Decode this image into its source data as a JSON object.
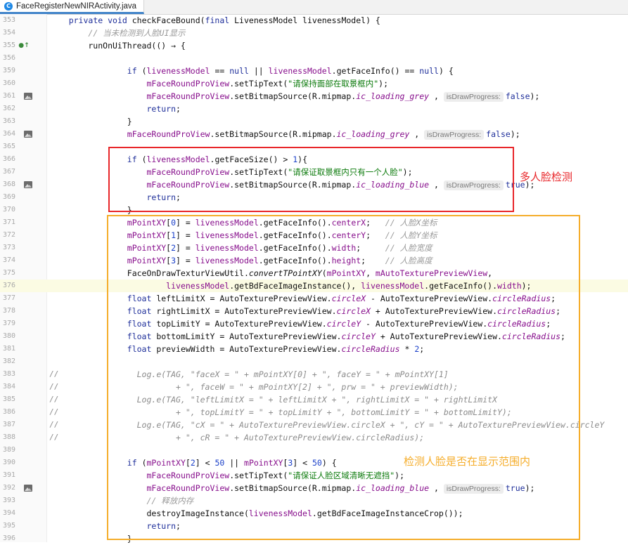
{
  "tab": {
    "icon_letter": "C",
    "label": "FaceRegisterNewNIRActivity.java",
    "accent": "#4083c9"
  },
  "gutter_icons": {
    "override": "override-up-arrow-icon",
    "image": "image-resource-icon",
    "lambda_mark": "lambda-marker-icon"
  },
  "lines": [
    {
      "n": "353",
      "tokens": [
        [
          "    "
        ],
        [
          "private void",
          "kw"
        ],
        [
          " checkFaceBound("
        ],
        [
          "final",
          "kw"
        ],
        [
          " LivenessModel livenessModel) {"
        ]
      ]
    },
    {
      "n": "354",
      "tokens": [
        [
          "        "
        ],
        [
          "// 当未检测到人脸UI显示",
          "cmt"
        ]
      ]
    },
    {
      "n": "355",
      "icon": "override",
      "tokens": [
        [
          "        runOnUiThread(() → {"
        ]
      ]
    },
    {
      "n": "356",
      "tokens": []
    },
    {
      "n": "359",
      "tokens": [
        [
          "                "
        ],
        [
          "if",
          "kw"
        ],
        [
          " ("
        ],
        [
          "livenessModel",
          "fld"
        ],
        [
          " == "
        ],
        [
          "null",
          "kw"
        ],
        [
          " || "
        ],
        [
          "livenessModel",
          "fld"
        ],
        [
          ".getFaceInfo() == "
        ],
        [
          "null",
          "kw"
        ],
        [
          ") {"
        ]
      ]
    },
    {
      "n": "360",
      "tokens": [
        [
          "                    "
        ],
        [
          "mFaceRoundProView",
          "fld"
        ],
        [
          ".setTipText("
        ],
        [
          "\"请保持面部在取景框内\"",
          "str"
        ],
        [
          ");"
        ]
      ]
    },
    {
      "n": "361",
      "icon": "image",
      "tokens": [
        [
          "                    "
        ],
        [
          "mFaceRoundProView",
          "fld"
        ],
        [
          ".setBitmapSource(R.mipmap."
        ],
        [
          "ic_loading_grey",
          "sfld"
        ],
        [
          " , "
        ],
        [
          "isDrawProgress:",
          "hint"
        ],
        [
          "false",
          "kw"
        ],
        [
          ");"
        ]
      ]
    },
    {
      "n": "362",
      "tokens": [
        [
          "                    "
        ],
        [
          "return",
          "kw"
        ],
        [
          ";"
        ]
      ]
    },
    {
      "n": "363",
      "tokens": [
        [
          "                }"
        ]
      ]
    },
    {
      "n": "364",
      "icon": "image",
      "tokens": [
        [
          "                "
        ],
        [
          "mFaceRoundProView",
          "fld"
        ],
        [
          ".setBitmapSource(R.mipmap."
        ],
        [
          "ic_loading_grey",
          "sfld"
        ],
        [
          " , "
        ],
        [
          "isDrawProgress:",
          "hint"
        ],
        [
          "false",
          "kw"
        ],
        [
          ");"
        ]
      ]
    },
    {
      "n": "365",
      "tokens": []
    },
    {
      "n": "366",
      "tokens": [
        [
          "                "
        ],
        [
          "if",
          "kw"
        ],
        [
          " ("
        ],
        [
          "livenessModel",
          "fld"
        ],
        [
          ".getFaceSize() > "
        ],
        [
          "1",
          "num"
        ],
        [
          "){"
        ]
      ]
    },
    {
      "n": "367",
      "tokens": [
        [
          "                    "
        ],
        [
          "mFaceRoundProView",
          "fld"
        ],
        [
          ".setTipText("
        ],
        [
          "\"请保证取景框内只有一个人脸\"",
          "str"
        ],
        [
          ");"
        ]
      ]
    },
    {
      "n": "368",
      "icon": "image",
      "tokens": [
        [
          "                    "
        ],
        [
          "mFaceRoundProView",
          "fld"
        ],
        [
          ".setBitmapSource(R.mipmap."
        ],
        [
          "ic_loading_blue",
          "sfld"
        ],
        [
          " , "
        ],
        [
          "isDrawProgress:",
          "hint"
        ],
        [
          "true",
          "kw"
        ],
        [
          ");"
        ]
      ]
    },
    {
      "n": "369",
      "tokens": [
        [
          "                    "
        ],
        [
          "return",
          "kw"
        ],
        [
          ";"
        ]
      ]
    },
    {
      "n": "370",
      "tokens": [
        [
          "                }"
        ]
      ]
    },
    {
      "n": "371",
      "tokens": [
        [
          "                "
        ],
        [
          "mPointXY",
          "fld"
        ],
        [
          "["
        ],
        [
          "0",
          "num"
        ],
        [
          "] = "
        ],
        [
          "livenessModel",
          "fld"
        ],
        [
          ".getFaceInfo()."
        ],
        [
          "centerX",
          "fld"
        ],
        [
          ";   "
        ],
        [
          "// 人脸X坐标",
          "cmt"
        ]
      ]
    },
    {
      "n": "372",
      "tokens": [
        [
          "                "
        ],
        [
          "mPointXY",
          "fld"
        ],
        [
          "["
        ],
        [
          "1",
          "num"
        ],
        [
          "] = "
        ],
        [
          "livenessModel",
          "fld"
        ],
        [
          ".getFaceInfo()."
        ],
        [
          "centerY",
          "fld"
        ],
        [
          ";   "
        ],
        [
          "// 人脸Y坐标",
          "cmt"
        ]
      ]
    },
    {
      "n": "373",
      "tokens": [
        [
          "                "
        ],
        [
          "mPointXY",
          "fld"
        ],
        [
          "["
        ],
        [
          "2",
          "num"
        ],
        [
          "] = "
        ],
        [
          "livenessModel",
          "fld"
        ],
        [
          ".getFaceInfo()."
        ],
        [
          "width",
          "fld"
        ],
        [
          ";     "
        ],
        [
          "// 人脸宽度",
          "cmt"
        ]
      ]
    },
    {
      "n": "374",
      "tokens": [
        [
          "                "
        ],
        [
          "mPointXY",
          "fld"
        ],
        [
          "["
        ],
        [
          "3",
          "num"
        ],
        [
          "] = "
        ],
        [
          "livenessModel",
          "fld"
        ],
        [
          ".getFaceInfo()."
        ],
        [
          "height",
          "fld"
        ],
        [
          ";    "
        ],
        [
          "// 人脸高度",
          "cmt"
        ]
      ]
    },
    {
      "n": "375",
      "tokens": [
        [
          "                FaceOnDrawTexturViewUtil."
        ],
        [
          "convertTPointXY",
          "smeth"
        ],
        [
          "("
        ],
        [
          "mPointXY",
          "fld"
        ],
        [
          ", "
        ],
        [
          "mAutoTexturePreviewView",
          "fld"
        ],
        [
          ","
        ]
      ]
    },
    {
      "n": "376",
      "current": true,
      "tokens": [
        [
          "                        "
        ],
        [
          "livenessModel",
          "fld"
        ],
        [
          ".getBdFaceImageInstance(), "
        ],
        [
          "livenessModel",
          "fld"
        ],
        [
          ".getFaceInfo()."
        ],
        [
          "width",
          "fld"
        ],
        [
          ");"
        ]
      ]
    },
    {
      "n": "377",
      "tokens": [
        [
          "                "
        ],
        [
          "float",
          "kw"
        ],
        [
          " leftLimitX = AutoTexturePreviewView."
        ],
        [
          "circleX",
          "sfld"
        ],
        [
          " - AutoTexturePreviewView."
        ],
        [
          "circleRadius",
          "sfld"
        ],
        [
          ";"
        ]
      ]
    },
    {
      "n": "378",
      "tokens": [
        [
          "                "
        ],
        [
          "float",
          "kw"
        ],
        [
          " rightLimitX = AutoTexturePreviewView."
        ],
        [
          "circleX",
          "sfld"
        ],
        [
          " + AutoTexturePreviewView."
        ],
        [
          "circleRadius",
          "sfld"
        ],
        [
          ";"
        ]
      ]
    },
    {
      "n": "379",
      "tokens": [
        [
          "                "
        ],
        [
          "float",
          "kw"
        ],
        [
          " topLimitY = AutoTexturePreviewView."
        ],
        [
          "circleY",
          "sfld"
        ],
        [
          " - AutoTexturePreviewView."
        ],
        [
          "circleRadius",
          "sfld"
        ],
        [
          ";"
        ]
      ]
    },
    {
      "n": "380",
      "tokens": [
        [
          "                "
        ],
        [
          "float",
          "kw"
        ],
        [
          " bottomLimitY = AutoTexturePreviewView."
        ],
        [
          "circleY",
          "sfld"
        ],
        [
          " + AutoTexturePreviewView."
        ],
        [
          "circleRadius",
          "sfld"
        ],
        [
          ";"
        ]
      ]
    },
    {
      "n": "381",
      "tokens": [
        [
          "                "
        ],
        [
          "float",
          "kw"
        ],
        [
          " previewWidth = AutoTexturePreviewView."
        ],
        [
          "circleRadius",
          "sfld"
        ],
        [
          " * "
        ],
        [
          "2",
          "num"
        ],
        [
          ";"
        ]
      ]
    },
    {
      "n": "382",
      "tokens": []
    },
    {
      "n": "383",
      "mark": "//",
      "tokens": [
        [
          "                  "
        ],
        [
          "Log.e(TAG, \"faceX = \" + mPointXY[0] + \", faceY = \" + mPointXY[1]",
          "lc"
        ]
      ]
    },
    {
      "n": "384",
      "mark": "//",
      "tokens": [
        [
          "                          "
        ],
        [
          "+ \", faceW = \" + mPointXY[2] + \", prw = \" + previewWidth);",
          "lc"
        ]
      ]
    },
    {
      "n": "385",
      "mark": "//",
      "tokens": [
        [
          "                  "
        ],
        [
          "Log.e(TAG, \"leftLimitX = \" + leftLimitX + \", rightLimitX = \" + rightLimitX",
          "lc"
        ]
      ]
    },
    {
      "n": "386",
      "mark": "//",
      "tokens": [
        [
          "                          "
        ],
        [
          "+ \", topLimitY = \" + topLimitY + \", bottomLimitY = \" + bottomLimitY);",
          "lc"
        ]
      ]
    },
    {
      "n": "387",
      "mark": "//",
      "tokens": [
        [
          "                  "
        ],
        [
          "Log.e(TAG, \"cX = \" + AutoTexturePreviewView.circleX + \", cY = \" + AutoTexturePreviewView.circleY",
          "lc"
        ]
      ]
    },
    {
      "n": "388",
      "mark": "//",
      "tokens": [
        [
          "                          "
        ],
        [
          "+ \", cR = \" + AutoTexturePreviewView.circleRadius);",
          "lc"
        ]
      ]
    },
    {
      "n": "389",
      "tokens": []
    },
    {
      "n": "390",
      "tokens": [
        [
          "                "
        ],
        [
          "if",
          "kw"
        ],
        [
          " ("
        ],
        [
          "mPointXY",
          "fld"
        ],
        [
          "["
        ],
        [
          "2",
          "num"
        ],
        [
          "] < "
        ],
        [
          "50",
          "num"
        ],
        [
          " || "
        ],
        [
          "mPointXY",
          "fld"
        ],
        [
          "["
        ],
        [
          "3",
          "num"
        ],
        [
          "] < "
        ],
        [
          "50",
          "num"
        ],
        [
          ") {"
        ]
      ]
    },
    {
      "n": "391",
      "tokens": [
        [
          "                    "
        ],
        [
          "mFaceRoundProView",
          "fld"
        ],
        [
          ".setTipText("
        ],
        [
          "\"请保证人脸区域清晰无遮挡\"",
          "str"
        ],
        [
          ");"
        ]
      ]
    },
    {
      "n": "392",
      "icon": "image",
      "tokens": [
        [
          "                    "
        ],
        [
          "mFaceRoundProView",
          "fld"
        ],
        [
          ".setBitmapSource(R.mipmap."
        ],
        [
          "ic_loading_blue",
          "sfld"
        ],
        [
          " , "
        ],
        [
          "isDrawProgress:",
          "hint"
        ],
        [
          "true",
          "kw"
        ],
        [
          ");"
        ]
      ]
    },
    {
      "n": "393",
      "tokens": [
        [
          "                    "
        ],
        [
          "// 释放内存",
          "cmt"
        ]
      ]
    },
    {
      "n": "394",
      "tokens": [
        [
          "                    destroyImageInstance("
        ],
        [
          "livenessModel",
          "fld"
        ],
        [
          ".getBdFaceImageInstanceCrop());"
        ]
      ]
    },
    {
      "n": "395",
      "tokens": [
        [
          "                    "
        ],
        [
          "return",
          "kw"
        ],
        [
          ";"
        ]
      ]
    },
    {
      "n": "396",
      "tokens": [
        [
          "                }"
        ]
      ]
    }
  ],
  "annotations": {
    "multi_face": {
      "text": "多人脸检测",
      "color": "#e8262a"
    },
    "in_range": {
      "text": "检测人脸是否在显示范围内",
      "color": "#f5ad2b"
    }
  }
}
